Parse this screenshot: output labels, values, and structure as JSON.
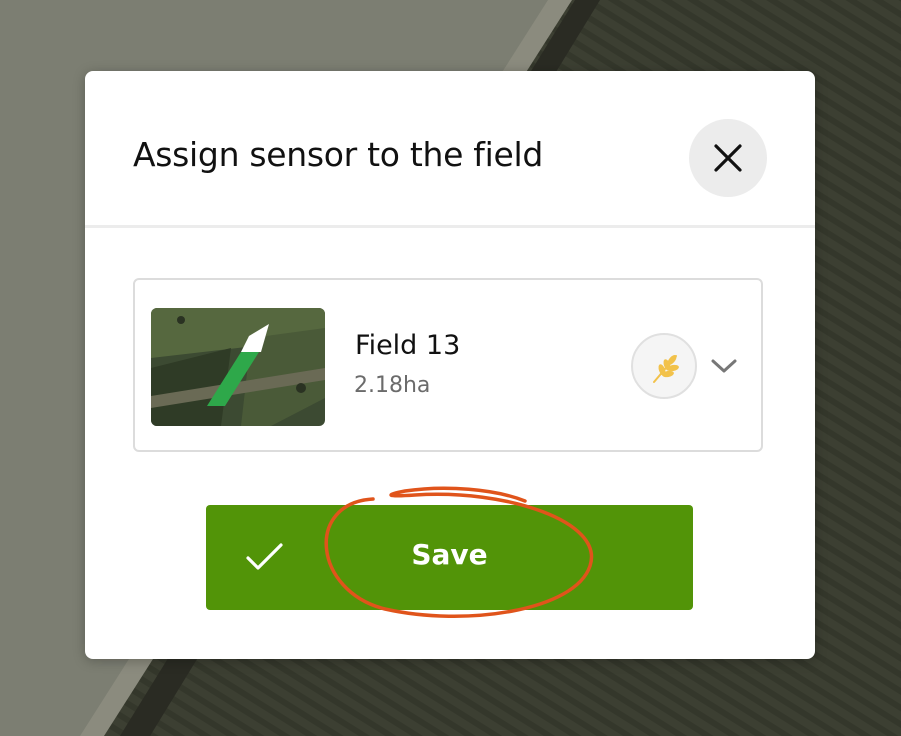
{
  "modal": {
    "title": "Assign sensor to the field",
    "close_icon": "close-icon"
  },
  "field": {
    "name": "Field 13",
    "area": "2.18ha",
    "thumbnail_icon": "field-satellite-thumbnail",
    "crop_icon": "wheat-icon",
    "dropdown_icon": "chevron-down-icon"
  },
  "save": {
    "label": "Save",
    "icon": "checkmark-icon"
  },
  "colors": {
    "primary": "#529408",
    "field_highlight": "#2ea84a",
    "annotation": "#e0541b",
    "crop_icon": "#f2c24b"
  }
}
